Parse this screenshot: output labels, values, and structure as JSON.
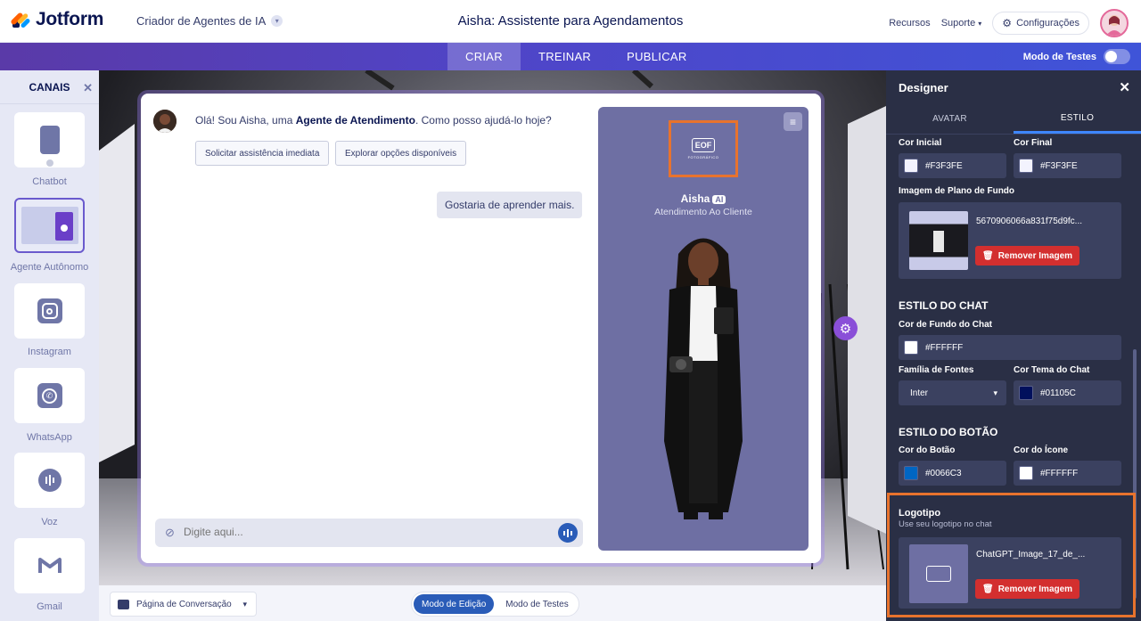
{
  "app": {
    "brand": "Jotform",
    "builder_label": "Criador de Agentes de IA",
    "title": "Aisha: Assistente para Agendamentos"
  },
  "header": {
    "resources": "Recursos",
    "support": "Suporte",
    "settings": "Configurações"
  },
  "nav": {
    "tabs": [
      "CRIAR",
      "TREINAR",
      "PUBLICAR"
    ],
    "active_tab": "CRIAR",
    "test_mode_label": "Modo de Testes"
  },
  "channels": {
    "title": "CANAIS",
    "items": [
      {
        "label": "Chatbot",
        "icon": "chatbot-icon"
      },
      {
        "label": "Agente Autônomo",
        "icon": "standalone-agent-icon",
        "selected": true
      },
      {
        "label": "Instagram",
        "icon": "instagram-icon"
      },
      {
        "label": "WhatsApp",
        "icon": "whatsapp-icon"
      },
      {
        "label": "Voz",
        "icon": "voice-icon"
      },
      {
        "label": "Gmail",
        "icon": "gmail-icon"
      }
    ]
  },
  "chat": {
    "greeting_prefix": "Olá! Sou Aisha, uma ",
    "greeting_bold": "Agente de Atendimento",
    "greeting_suffix": ". Como posso ajudá-lo hoje?",
    "chips": [
      "Solicitar assistência imediata",
      "Explorar opções disponíveis"
    ],
    "user_message": "Gostaria de aprender mais.",
    "input_placeholder": "Digite aqui..."
  },
  "agent_card": {
    "name": "Aisha",
    "badge": "AI",
    "role": "Atendimento Ao Cliente",
    "logo_text": "EOF",
    "logo_sub": "FOTOGRÁFICO"
  },
  "bottom": {
    "page_select": "Página de Conversação",
    "modes": [
      "Modo de Edição",
      "Modo de Testes"
    ],
    "active_mode": "Modo de Edição"
  },
  "designer": {
    "title": "Designer",
    "tabs": [
      "AVATAR",
      "ESTILO"
    ],
    "active_tab": "ESTILO",
    "start_color_label": "Cor Inicial",
    "start_color": "#F3F3FE",
    "end_color_label": "Cor Final",
    "end_color": "#F3F3FE",
    "bg_image_label": "Imagem de Plano de Fundo",
    "bg_image_file": "5670906066a831f75d9fc...",
    "remove_image": "Remover Imagem",
    "chat_style_title": "ESTILO DO CHAT",
    "chat_bg_label": "Cor de Fundo do Chat",
    "chat_bg": "#FFFFFF",
    "font_label": "Família de Fontes",
    "font_value": "Inter",
    "theme_label": "Cor Tema do Chat",
    "theme_color": "#01105C",
    "button_style_title": "ESTILO DO BOTÃO",
    "button_color_label": "Cor do Botão",
    "button_color": "#0066C3",
    "icon_color_label": "Cor do Ícone",
    "icon_color": "#FFFFFF",
    "logo_title": "Logotipo",
    "logo_hint": "Use seu logotipo no chat",
    "logo_file": "ChatGPT_Image_17_de_..."
  }
}
